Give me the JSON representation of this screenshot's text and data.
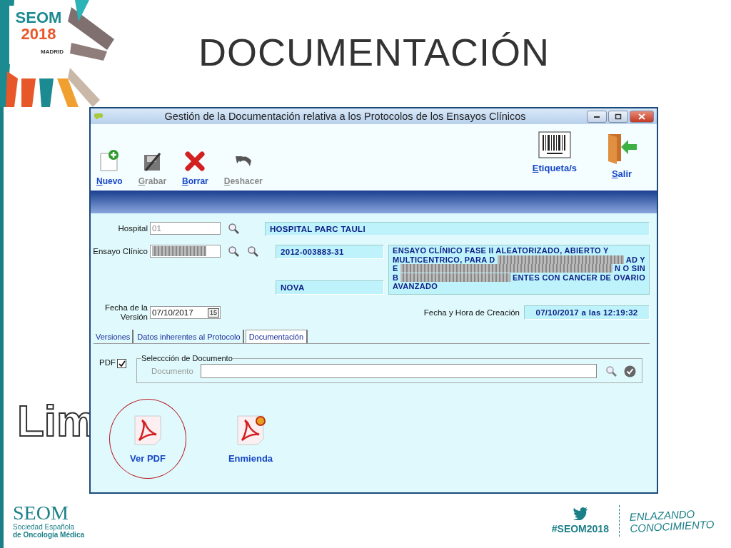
{
  "slide": {
    "logo": {
      "name": "SEOM",
      "year": "2018",
      "city": "MADRID"
    },
    "title": "DOCUMENTACIÓN",
    "covered_heading": "Lim"
  },
  "window": {
    "title": "Gestión de la Documentación relativa a los Protocolos de los Ensayos Clínicos",
    "toolbar": [
      {
        "label": "Nuevo",
        "kind": "new",
        "disabled": false
      },
      {
        "label": "Grabar",
        "kind": "save",
        "disabled": true
      },
      {
        "label": "Borrar",
        "kind": "delete",
        "disabled": false
      },
      {
        "label": "Deshacer",
        "kind": "undo",
        "disabled": true
      }
    ],
    "toolbar_right": [
      {
        "label": "Etiqueta/s",
        "kind": "barcode"
      },
      {
        "label": "Salir",
        "kind": "exit"
      }
    ],
    "hospital": {
      "label": "Hospital",
      "value": "01",
      "name": "HOSPITAL PARC TAULI"
    },
    "trial": {
      "label": "Ensayo Clínico",
      "code": "2012-003883-31",
      "sponsor": "NOVA",
      "description_lines": [
        {
          "before": "ENSAYO CLÍNICO FASE II ALEATORIZADO, ABIERTO Y"
        },
        {
          "before": "MULTICENTRICO, PARA D",
          "after": "AD Y"
        },
        {
          "before": "E",
          "after": "N O SIN"
        },
        {
          "before": "B",
          "after": "ENTES CON CANCER DE OVARIO"
        },
        {
          "before": "AVANZADO"
        }
      ]
    },
    "version_date": {
      "label": "Fecha de la Versión",
      "value": "07/10/2017",
      "calendar": "15"
    },
    "created": {
      "label": "Fecha y Hora de Creación",
      "value": "07/10/2017 a las 12:19:32"
    },
    "tabs": [
      {
        "label": "Versiones",
        "selected": false
      },
      {
        "label": "Datos inherentes al Protocolo",
        "selected": false
      },
      {
        "label": "Documentación",
        "selected": true
      }
    ],
    "pdf": {
      "label": "PDF",
      "checked": true
    },
    "group": {
      "legend": "Seleccción de Documento",
      "field_label": "Documento"
    },
    "actions": [
      {
        "label": "Ver PDF",
        "highlighted": true,
        "badge": false
      },
      {
        "label": "Enmienda",
        "highlighted": false,
        "badge": true
      }
    ]
  },
  "footer": {
    "org": "SEOM",
    "org_line1": "Sociedad Española",
    "org_line2": "de Oncología Médica",
    "hashtag": "#SEOM2018",
    "motto_line1": "ENLAZANDO",
    "motto_line2": "CONOCIMIENTO"
  }
}
